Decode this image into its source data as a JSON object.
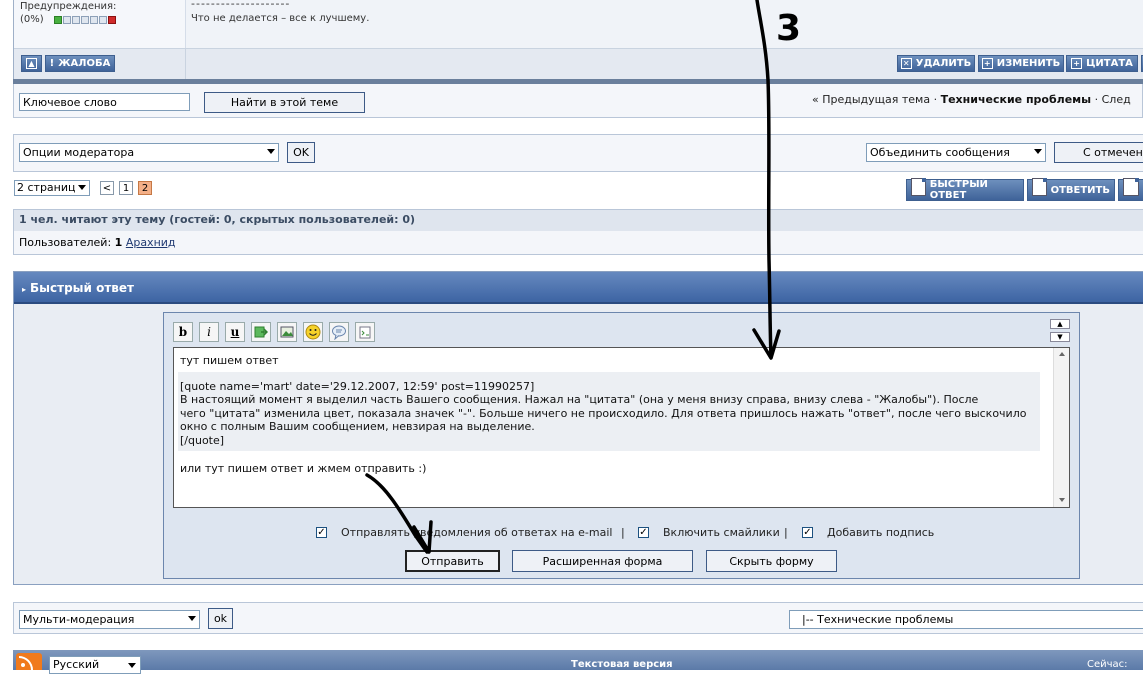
{
  "post": {
    "warnings_label": "Предупреждения:",
    "warnings_percent": "(0%)",
    "warning_level": 0,
    "signature_separator": "--------------------",
    "signature_text": "Что не делается – все к лучшему.",
    "buttons": {
      "up_icon": "arrow-up-icon",
      "complain": "ЖАЛОБА",
      "delete": "УДАЛИТЬ",
      "edit": "ИЗМЕНИТЬ",
      "quote": "ЦИТАТА"
    }
  },
  "search": {
    "keyword_value": "Ключевое слово",
    "find_button": "Найти в этой теме",
    "nav_prev": "« Предыдущая тема",
    "nav_sep": " · ",
    "nav_current": "Технические проблемы",
    "nav_next": "След"
  },
  "moderation": {
    "mod_options": "Опции модератора",
    "ok": "OK",
    "merge": "Объединить сообщения",
    "marked": "С отмечен"
  },
  "pagination": {
    "pages_select": "2 страниц",
    "prev": "<",
    "page1": "1",
    "page2": "2",
    "quick_reply_btn": "БЫСТРЫЙ ОТВЕТ",
    "reply_btn": "ОТВЕТИТЬ"
  },
  "readers": {
    "heading": "1 чел. читают эту тему (гостей: 0, скрытых пользователей: 0)",
    "users_label": "Пользователей: ",
    "users_count": "1",
    "user_name": "Арахнид"
  },
  "quick_reply": {
    "title": "Быстрый ответ",
    "toolbar": [
      "b",
      "i",
      "u"
    ],
    "text_lines": {
      "l1": "тут пишем ответ",
      "l2": "[quote name='mart' date='29.12.2007, 12:59' post=11990257]",
      "l3": "В настоящий момент я выделил часть Вашего сообщения. Нажал на \"цитата\" (она у меня внизу справа, внизу слева - \"Жалобы\"). После",
      "l4": "чего \"цитата\" изменила цвет, показала значек \"-\". Больше ничего не происходило. Для ответа пришлось нажать \"ответ\", после чего выскочило",
      "l5": "окно с полным Вашим сообщением, невзирая на выделение.",
      "l6": "[/quote]",
      "l7": "или тут пишем ответ и жмем отправить :)"
    },
    "options": {
      "email": "Отправлять уведомления об ответах на e-mail",
      "sep": "|",
      "smilies": "Включить смайлики",
      "signature": "Добавить подпись"
    },
    "send": "Отправить",
    "advanced": "Расширенная форма",
    "hide": "Скрыть форму"
  },
  "multi": {
    "multi_mod": "Мульти-модерация",
    "ok": "ok",
    "jump": "|-- Технические проблемы"
  },
  "footer": {
    "language": "Русский",
    "text_version": "Текстовая версия",
    "now": "Сейчас: "
  },
  "annotation": {
    "label": "3"
  }
}
